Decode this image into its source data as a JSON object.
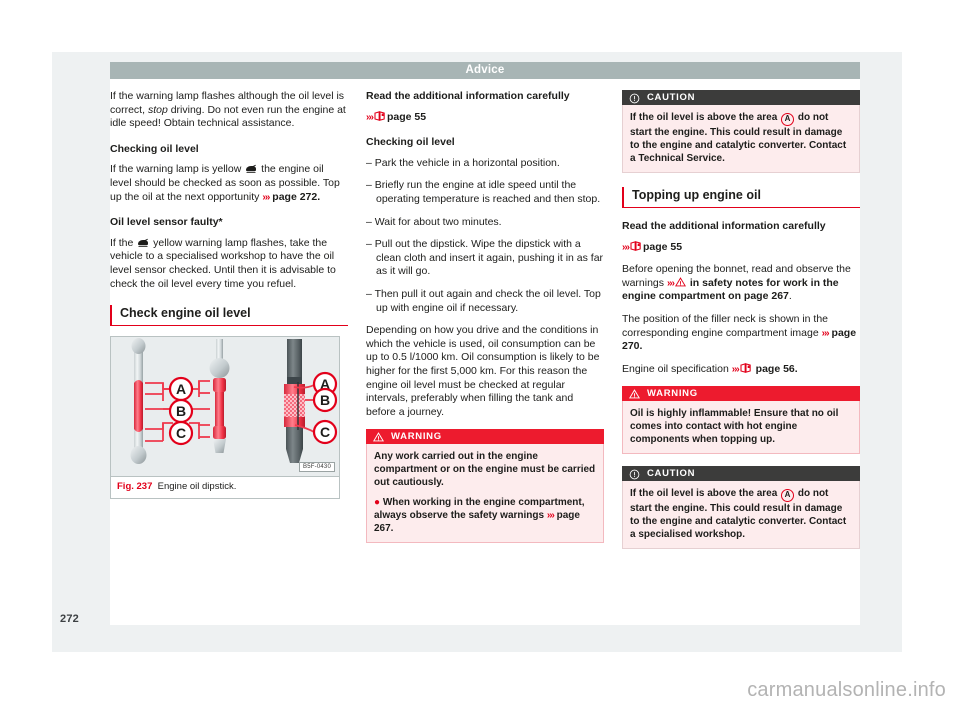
{
  "header": {
    "title": "Advice"
  },
  "page_number": "272",
  "watermark": "carmanualsonline.info",
  "left_column": {
    "intro_paragraph": {
      "part1": "If the warning lamp flashes although the oil level is correct, ",
      "italic": "stop",
      "part2": " driving. Do not even run the engine at idle speed! Obtain technical assistance."
    },
    "heading_checking": "Checking oil level",
    "checking_text": {
      "part1": "If the warning lamp is yellow ",
      "icon": "oil-lamp-icon",
      "part2": " the engine oil level should be checked as soon as possible. Top up the oil at the next opportunity ",
      "arrow": "›››",
      "page_ref": " page 272."
    },
    "heading_sensor": "Oil level sensor faulty*",
    "sensor_text": {
      "part1": "If the ",
      "icon": "oil-lamp-icon",
      "part2": " yellow warning lamp flashes, take the vehicle to a specialised workshop to have the oil level sensor checked. Until then it is advisable to check the oil level every time you refuel."
    },
    "section_title": "Check engine oil level",
    "figure": {
      "number": "Fig. 237",
      "caption": "Engine oil dipstick.",
      "code": "B5F-0430",
      "labels": [
        "A",
        "B",
        "C"
      ]
    }
  },
  "middle_column": {
    "read_info_heading": "Read the additional information carefully",
    "read_info_ref": {
      "arrow": "›››",
      "icon": "book-icon",
      "page": "page 55"
    },
    "heading_checking": "Checking oil level",
    "steps": [
      "Park the vehicle in a horizontal position.",
      "Briefly run the engine at idle speed until the operating temperature is reached and then stop.",
      "Wait for about two minutes.",
      "Pull out the dipstick. Wipe the dipstick with a clean cloth and insert it again, pushing it in as far as it will go.",
      "Then pull it out again and check the oil level. Top up with engine oil if necessary."
    ],
    "consumption_paragraph": "Depending on how you drive and the conditions in which the vehicle is used, oil consumption can be up to 0.5 l/1000 km. Oil consumption is likely to be higher for the first 5,000 km. For this reason the engine oil level must be checked at regular intervals, preferably when filling the tank and before a journey.",
    "warning_box": {
      "label": "WARNING",
      "icon": "warning-triangle-icon",
      "text": "Any work carried out in the engine compartment or on the engine must be carried out cautiously.",
      "bullet_marker": "●",
      "bullet_text": "When working in the engine compartment, always observe the safety warnings ",
      "bullet_arrow": "›››",
      "bullet_page": " page 267."
    }
  },
  "right_column": {
    "caution_box_top": {
      "label": "CAUTION",
      "icon": "exclamation-circle-icon",
      "text_part1": "If the oil level is above the area ",
      "circle_label": "A",
      "text_part2": " do not start the engine. This could result in damage to the engine and catalytic converter. Contact a Technical Service."
    },
    "section_title": "Topping up engine oil",
    "read_info_heading": "Read the additional information carefully",
    "read_info_ref": {
      "arrow": "›››",
      "icon": "book-icon",
      "page": "page 55"
    },
    "bonnet_paragraph": {
      "part1": "Before opening the bonnet, read and observe the warnings ",
      "arrow": "›››",
      "icon": "warning-triangle-icon",
      "part2": " in safety notes for work in the engine compartment on page 267",
      "part3": "."
    },
    "filler_paragraph": {
      "part1": "The position of the filler neck is shown in the corresponding engine compartment image ",
      "arrow": "›››",
      "part2": " page 270."
    },
    "spec_paragraph": {
      "part1": "Engine oil specification ",
      "arrow": "›››",
      "icon": "book-icon",
      "part2": " page 56."
    },
    "warning_box": {
      "label": "WARNING",
      "icon": "warning-triangle-icon",
      "text": "Oil is highly inflammable! Ensure that no oil comes into contact with hot engine components when topping up."
    },
    "caution_box_bottom": {
      "label": "CAUTION",
      "icon": "exclamation-circle-icon",
      "text_part1": "If the oil level is above the area ",
      "circle_label": "A",
      "text_part2": " do not start the engine. This could result in damage to the engine and catalytic converter. Contact a specialised workshop."
    }
  },
  "colors": {
    "accent_red": "#e2001a",
    "warning_red": "#ed1b2e",
    "caution_dark": "#3c3c3b",
    "header_grey": "#a8b5b5",
    "box_body_pink": "#fdeced",
    "page_bg": "#eef1f2"
  }
}
